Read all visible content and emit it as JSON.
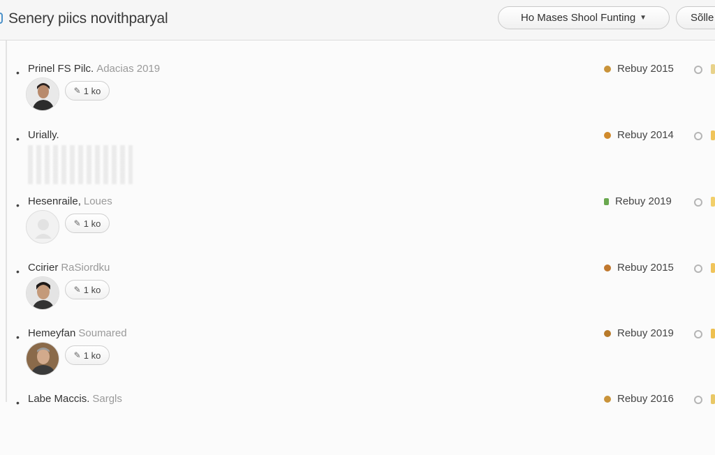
{
  "header": {
    "title": "Senery piics novithparyal",
    "dropdown_label": "Ho Mases Shool Funting",
    "side_button_label": "Sõlle"
  },
  "rows": [
    {
      "name": "Prinel FS Pilc.",
      "sub": "Adacias 2019",
      "chip_label": "1 ko",
      "status_label": "Rebuy 2015",
      "dot_color": "#c9933a",
      "avatar": "person-dark-hair",
      "edge_color": "#e8d28a"
    },
    {
      "name": "Urially.",
      "sub": "",
      "chip_label": "",
      "status_label": "Rebuy 2014",
      "dot_color": "#d08a2c",
      "avatar": "",
      "edge_color": "#f0c45a"
    },
    {
      "name": "Hesenraile,",
      "sub": "Loues",
      "chip_label": "1 ko",
      "status_label": "Rebuy 2019",
      "dot_color": "#6aa84f",
      "avatar": "placeholder",
      "edge_color": "#f2cf6a"
    },
    {
      "name": "Ccirier",
      "sub": "RaSiordku",
      "chip_label": "1 ko",
      "status_label": "Rebuy 2015",
      "dot_color": "#c0782e",
      "avatar": "person-dark-hair",
      "edge_color": "#f0c45a"
    },
    {
      "name": "Hemeyfan",
      "sub": "Soumared",
      "chip_label": "1 ko",
      "status_label": "Rebuy 2019",
      "dot_color": "#b87a2a",
      "avatar": "person-older",
      "edge_color": "#eec050"
    },
    {
      "name": "Labe Maccis.",
      "sub": "Sargls",
      "chip_label": "",
      "status_label": "Rebuy 2016",
      "dot_color": "#c9933a",
      "avatar": "",
      "edge_color": "#e9c866"
    }
  ]
}
